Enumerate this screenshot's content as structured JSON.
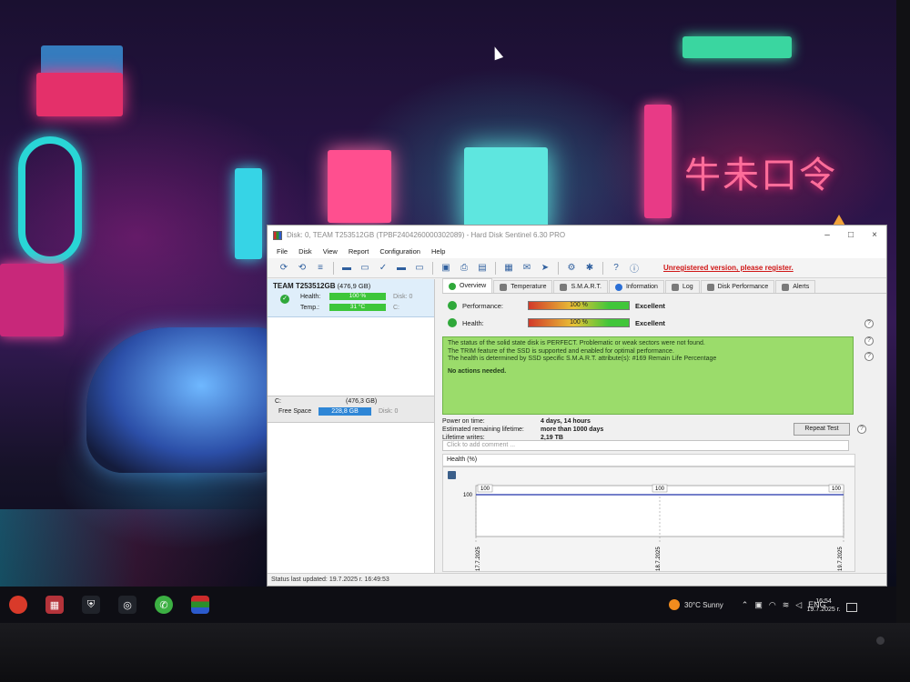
{
  "window": {
    "title": "Disk: 0, TEAM T253512GB (TPBF2404260000302089) - Hard Disk Sentinel 6.30 PRO",
    "controls": [
      "–",
      "□",
      "×"
    ]
  },
  "menu": [
    "File",
    "Disk",
    "View",
    "Report",
    "Configuration",
    "Help"
  ],
  "toolbar": {
    "unregistered": "Unregistered version, please register."
  },
  "left_panel": {
    "disk_name": "TEAM T253512GB",
    "disk_size": "(476,9 GB)",
    "health_label": "Health:",
    "health_value": "100 %",
    "health_disk": "Disk: 0",
    "temp_label": "Temp.:",
    "temp_value": "31 °C",
    "temp_drive": "C:",
    "volume_letter": "C:",
    "volume_size": "(476,3 GB)",
    "free_label": "Free Space",
    "free_value": "228,8 GB",
    "free_disk": "Disk: 0"
  },
  "tabs": [
    "Overview",
    "Temperature",
    "S.M.A.R.T.",
    "Information",
    "Log",
    "Disk Performance",
    "Alerts"
  ],
  "overview": {
    "performance_label": "Performance:",
    "performance_value": "100 %",
    "performance_pct": 100,
    "performance_grade": "Excellent",
    "health_label": "Health:",
    "health_value": "100 %",
    "health_pct": 100,
    "health_grade": "Excellent",
    "status_lines": [
      "The status of the solid state disk is PERFECT. Problematic or weak sectors were not found.",
      "The TRIM feature of the SSD is supported and enabled for optimal performance.",
      "The health is determined by SSD specific S.M.A.R.T. attribute(s):  #169 Remain Life Percentage"
    ],
    "status_action": "No actions needed.",
    "power_on_label": "Power on time:",
    "power_on_value": "4 days, 14 hours",
    "remaining_label": "Estimated remaining lifetime:",
    "remaining_value": "more than 1000 days",
    "writes_label": "Lifetime writes:",
    "writes_value": "2,19 TB",
    "repeat_button": "Repeat Test",
    "comment_placeholder": "Click to add comment ...",
    "health_chart_title": "Health (%)"
  },
  "chart_data": {
    "type": "line",
    "x": [
      "17.7.2025",
      "18.7.2025",
      "19.7.2025"
    ],
    "values": [
      100,
      100,
      100
    ],
    "xlabel": "",
    "ylabel": "",
    "ytick": "100",
    "grid": false,
    "color": "#2233aa"
  },
  "statusbar": {
    "text": "Status last updated: 19.7.2025 г. 16:49:53"
  },
  "taskbar": {
    "weather": "30°C  Sunny",
    "lang": "ENG",
    "time": "16:54",
    "date": "19.7.2025 г."
  },
  "colors": {
    "ok_green": "#2fa83a",
    "status_green": "#9bdc6b",
    "unregistered_red": "#d01818",
    "free_space_blue": "#2e86d6"
  }
}
